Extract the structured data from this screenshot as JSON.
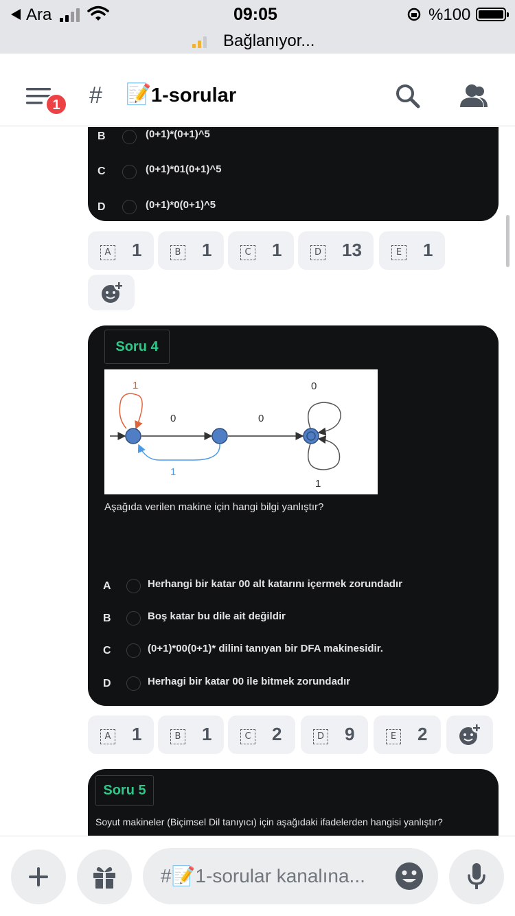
{
  "status_bar": {
    "carrier": "Ara",
    "time": "09:05",
    "battery": "%100",
    "connection_status": "Bağlanıyor..."
  },
  "header": {
    "channel_hash": "#",
    "channel_emoji": "📝",
    "channel_name": "1-sorular",
    "notification_count": "1"
  },
  "question3": {
    "options": [
      {
        "letter": "B",
        "text": "(0+1)*(0+1)^5"
      },
      {
        "letter": "C",
        "text": "(0+1)*01(0+1)^5"
      },
      {
        "letter": "D",
        "text": "(0+1)*0(0+1)^5"
      }
    ],
    "reactions": [
      {
        "emoji": "A",
        "count": "1"
      },
      {
        "emoji": "B",
        "count": "1"
      },
      {
        "emoji": "C",
        "count": "1"
      },
      {
        "emoji": "D",
        "count": "13"
      },
      {
        "emoji": "E",
        "count": "1"
      }
    ]
  },
  "question4": {
    "title": "Soru 4",
    "diagram_labels": {
      "self_loop_1": "1",
      "edge_q0_q1": "0",
      "edge_q1_q2": "0",
      "edge_q1_q0": "1",
      "loop_top": "0",
      "loop_bottom": "1"
    },
    "question": "Aşağıda verilen makine için hangi bilgi yanlıştır?",
    "options": [
      {
        "letter": "A",
        "text": "Herhangi bir katar 00 alt katarını içermek zorundadır"
      },
      {
        "letter": "B",
        "text": "Boş katar bu dile ait değildir"
      },
      {
        "letter": "C",
        "text": "(0+1)*00(0+1)* dilini tanıyan bir DFA makinesidir."
      },
      {
        "letter": "D",
        "text": "Herhagi bir katar 00  ile bitmek zorundadır"
      }
    ],
    "reactions": [
      {
        "emoji": "A",
        "count": "1"
      },
      {
        "emoji": "B",
        "count": "1"
      },
      {
        "emoji": "C",
        "count": "2"
      },
      {
        "emoji": "D",
        "count": "9"
      },
      {
        "emoji": "E",
        "count": "2"
      }
    ]
  },
  "question5": {
    "title": "Soru 5",
    "question": "Soyut makineler (Biçimsel Dil tanıyıcı) için aşağıdaki ifadelerden hangisi yanlıştır?"
  },
  "composer": {
    "placeholder": "#📝1-sorular kanalına..."
  },
  "icons": {
    "menu": "menu-icon",
    "search": "search-icon",
    "members": "members-icon",
    "add": "plus-icon",
    "gift": "gift-icon",
    "emoji": "emoji-icon",
    "mic": "microphone-icon",
    "add_reaction": "add-reaction-icon"
  },
  "colors": {
    "accent_green": "#2dc88a",
    "badge_red": "#ed4245",
    "card_bg": "#111214"
  }
}
